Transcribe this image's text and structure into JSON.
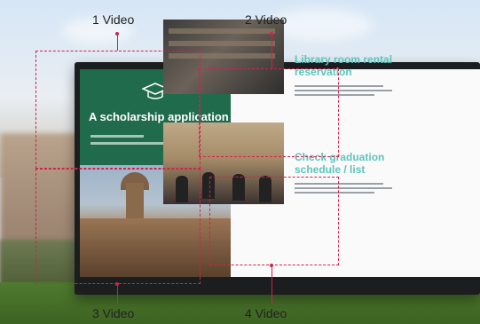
{
  "labels": {
    "video1": "1 Video",
    "video2": "2 Video",
    "video3": "3 Video",
    "video4": "4 Video"
  },
  "screen": {
    "panel1_title": "A scholarship application",
    "panel2_heading": "Library room rental reservation",
    "panel4_heading": "Check graduation schedule / list"
  },
  "colors": {
    "annotation": "#d4214b",
    "panel1_bg": "#1f6b4c",
    "heading_teal": "#5cc5bd"
  },
  "icons": {
    "panel1_icon": "graduation-cap-icon"
  }
}
